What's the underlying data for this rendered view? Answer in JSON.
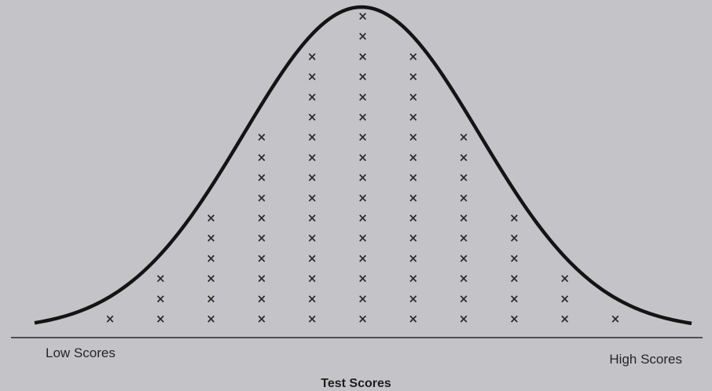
{
  "chart_data": {
    "type": "scatter",
    "title": "",
    "xlabel": "Test Scores",
    "ylabel": "",
    "x_axis_left_label": "Low Scores",
    "x_axis_right_label": "High Scores",
    "marker": "×",
    "curve": "normal distribution",
    "grid": false,
    "x": [
      1,
      2,
      3,
      4,
      5,
      6,
      7,
      8,
      9,
      10,
      11
    ],
    "counts": [
      1,
      3,
      6,
      10,
      14,
      16,
      14,
      10,
      6,
      3,
      1
    ],
    "colors": {
      "marks": "#2b2b2b",
      "curve": "#141414",
      "axis": "#2a2a2a",
      "background": "#c4c4c8"
    }
  }
}
